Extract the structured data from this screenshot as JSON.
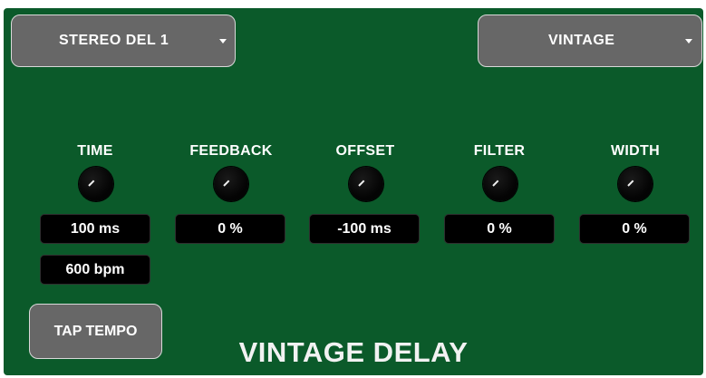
{
  "preset_dropdown": {
    "label": "STEREO DEL 1"
  },
  "type_dropdown": {
    "label": "VINTAGE"
  },
  "params": [
    {
      "label": "TIME",
      "value": "100 ms",
      "secondary": "600 bpm"
    },
    {
      "label": "FEEDBACK",
      "value": "0 %"
    },
    {
      "label": "OFFSET",
      "value": "-100 ms"
    },
    {
      "label": "FILTER",
      "value": "0 %"
    },
    {
      "label": "WIDTH",
      "value": "0 %"
    }
  ],
  "tap_tempo": {
    "label": "TAP TEMPO"
  },
  "effect_title": "VINTAGE DELAY",
  "colors": {
    "panel_bg": "#0b5a2a",
    "button_bg": "#676767",
    "value_bg": "#000000",
    "text": "#ffffff"
  },
  "icons": {
    "dropdown_caret": "caret-down-icon",
    "knob": "rotary-knob"
  }
}
